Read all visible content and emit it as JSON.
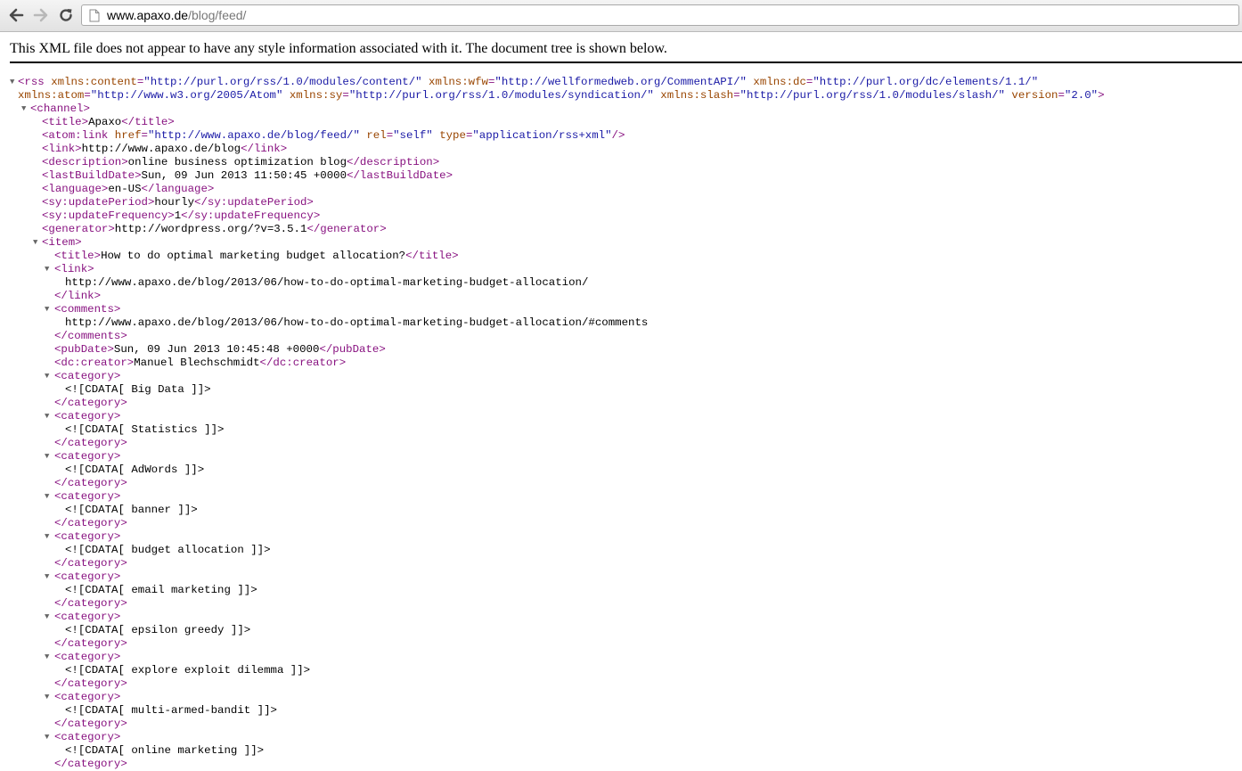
{
  "browser": {
    "url_host": "www.apaxo.de",
    "url_path": "/blog/feed/"
  },
  "notice": "This XML file does not appear to have any style information associated with it. The document tree is shown below.",
  "xml": {
    "rss_open": "<rss",
    "rss_attrs_line1": [
      {
        "name": "xmlns:content",
        "value": "\"http://purl.org/rss/1.0/modules/content/\""
      },
      {
        "name": "xmlns:wfw",
        "value": "\"http://wellformedweb.org/CommentAPI/\""
      },
      {
        "name": "xmlns:dc",
        "value": "\"http://purl.org/dc/elements/1.1/\""
      }
    ],
    "rss_attrs_line2": [
      {
        "name": "xmlns:atom",
        "value": "\"http://www.w3.org/2005/Atom\""
      },
      {
        "name": "xmlns:sy",
        "value": "\"http://purl.org/rss/1.0/modules/syndication/\""
      },
      {
        "name": "xmlns:slash",
        "value": "\"http://purl.org/rss/1.0/modules/slash/\""
      },
      {
        "name": "version",
        "value": "\"2.0\""
      }
    ],
    "channel_open": "<channel>",
    "channel_fields": [
      {
        "tag": "title",
        "text": "Apaxo"
      },
      {
        "tag": "link",
        "text": "http://www.apaxo.de/blog"
      },
      {
        "tag": "description",
        "text": "online business optimization blog"
      },
      {
        "tag": "lastBuildDate",
        "text": "Sun, 09 Jun 2013 11:50:45 +0000"
      },
      {
        "tag": "language",
        "text": "en-US"
      },
      {
        "tag": "sy:updatePeriod",
        "text": "hourly"
      },
      {
        "tag": "sy:updateFrequency",
        "text": "1"
      },
      {
        "tag": "generator",
        "text": "http://wordpress.org/?v=3.5.1"
      }
    ],
    "atom_link": {
      "tag": "atom:link",
      "attrs": [
        {
          "name": "href",
          "value": "\"http://www.apaxo.de/blog/feed/\""
        },
        {
          "name": "rel",
          "value": "\"self\""
        },
        {
          "name": "type",
          "value": "\"application/rss+xml\""
        }
      ]
    },
    "item_open": "<item>",
    "item": {
      "title": "How to do optimal marketing budget allocation?",
      "link": "http://www.apaxo.de/blog/2013/06/how-to-do-optimal-marketing-budget-allocation/",
      "comments": "http://www.apaxo.de/blog/2013/06/how-to-do-optimal-marketing-budget-allocation/#comments",
      "pubDate": "Sun, 09 Jun 2013 10:45:48 +0000",
      "creator": "Manuel Blechschmidt",
      "categories": [
        "<![CDATA[ Big Data ]]>",
        "<![CDATA[ Statistics ]]>",
        "<![CDATA[ AdWords ]]>",
        "<![CDATA[ banner ]]>",
        "<![CDATA[ budget allocation ]]>",
        "<![CDATA[ email marketing ]]>",
        "<![CDATA[ epsilon greedy ]]>",
        "<![CDATA[ explore exploit dilemma ]]>",
        "<![CDATA[ multi-armed-bandit ]]>",
        "<![CDATA[ online marketing ]]>"
      ]
    },
    "tags": {
      "link_open": "<link>",
      "link_close": "</link>",
      "comments_open": "<comments>",
      "comments_close": "</comments>",
      "category_open": "<category>",
      "category_close": "</category>",
      "pubDate_open": "<pubDate>",
      "pubDate_close": "</pubDate>",
      "creator_open": "<dc:creator>",
      "creator_close": "</dc:creator>",
      "title_open": "<title>",
      "title_close": "</title>",
      "rss_end": ">",
      "selfclose": "/>"
    },
    "toggle_glyph": "▼"
  }
}
